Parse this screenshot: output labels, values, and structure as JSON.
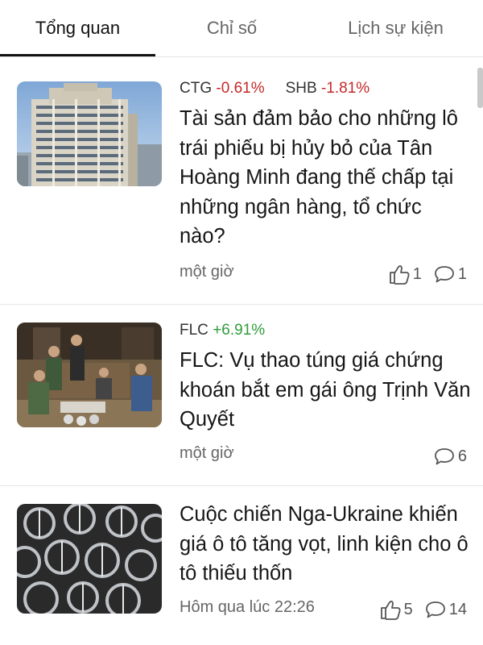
{
  "tabs": [
    {
      "label": "Tổng quan",
      "active": true
    },
    {
      "label": "Chỉ số",
      "active": false
    },
    {
      "label": "Lịch sự kiện",
      "active": false
    }
  ],
  "colors": {
    "negative": "#c62828",
    "positive": "#2e9b3a"
  },
  "articles": [
    {
      "tickers": [
        {
          "symbol": "CTG",
          "change": "-0.61%"
        },
        {
          "symbol": "SHB",
          "change": "-1.81%"
        }
      ],
      "title": "Tài sản đảm bảo cho những lô trái phiếu bị hủy bỏ của Tân Hoàng Minh đang thế chấp tại những ngân hàng, tổ chức nào?",
      "time": "một giờ",
      "likes": "1",
      "comments": "1",
      "image_icon": "building-photo"
    },
    {
      "tickers": [
        {
          "symbol": "FLC",
          "change": "+6.91%"
        }
      ],
      "title": "FLC: Vụ thao túng giá chứng khoán bắt em gái ông Trịnh Văn Quyết",
      "time": "một giờ",
      "comments": "6",
      "image_icon": "police-raid-photo"
    },
    {
      "title": "Cuộc chiến Nga-Ukraine khiến giá ô tô tăng vọt, linh kiện cho ô tô thiếu thốn",
      "time": "Hôm qua lúc 22:26",
      "likes": "5",
      "comments": "14",
      "image_icon": "car-parts-photo"
    }
  ]
}
